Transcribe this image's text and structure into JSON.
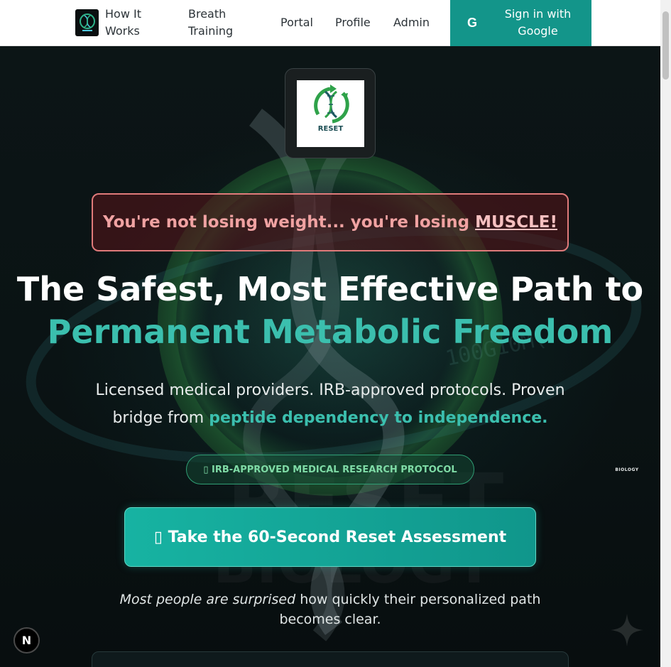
{
  "nav": {
    "how_it_works": "How It Works",
    "breath_training": "Breath Training",
    "portal": "Portal",
    "profile": "Profile",
    "admin": "Admin",
    "sign_in": "Sign in with Google",
    "google_glyph": "G"
  },
  "hero": {
    "logo_text": "RESET",
    "logo_subtext": "BIOLOGY",
    "warning_prefix": "You're not losing weight... you're losing ",
    "warning_emphasis": "MUSCLE!",
    "headline_line1": "The Safest, Most Effective Path to",
    "headline_line2": "Permanent Metabolic Freedom",
    "subtitle_plain": "Licensed medical providers. IRB-approved protocols. Proven bridge from ",
    "subtitle_highlight": "peptide dependency to independence.",
    "badge_label": "▯ IRB-APPROVED MEDICAL RESEARCH PROTOCOL",
    "cta_label": "▯ Take the 60-Second Reset Assessment",
    "note_emphasis": "Most people are surprised",
    "note_rest": " how quickly their personalized path becomes clear."
  },
  "devtools": {
    "badge_letter": "N"
  },
  "colors": {
    "accent": "#13958a",
    "teal_text": "#3bbfae",
    "warning_border": "#e07a7a",
    "badge_text": "#7fdba6"
  }
}
